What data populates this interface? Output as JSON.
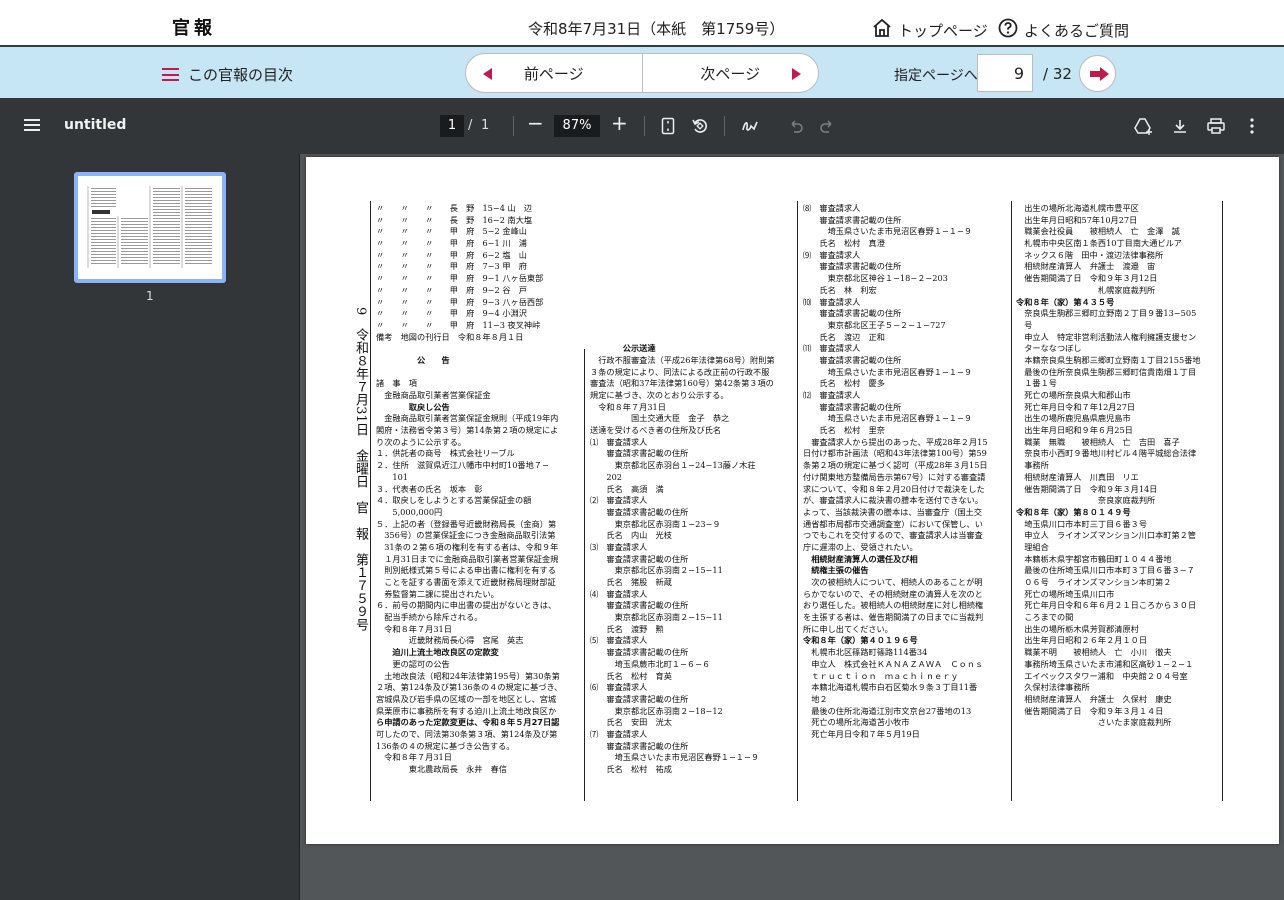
{
  "site": {
    "logo": "官報",
    "issue_title": "令和8年7月31日（本紙　第1759号）",
    "top_link": "トップページ",
    "faq_link": "よくあるご質問"
  },
  "nav": {
    "toc_label": "この官報の目次",
    "prev_label": "前ページ",
    "next_label": "次ページ",
    "goto_label": "指定ページへ",
    "current_page": "9",
    "total_pages": "/ 32"
  },
  "pdf_toolbar": {
    "title": "untitled",
    "page_current": "1",
    "page_sep": "/",
    "page_total": "1",
    "zoom": "87%"
  },
  "sidebar": {
    "thumbnail_label": "1"
  },
  "document": {
    "masthead": "9　令和８年７月31日　金曜日　官　報　第１７５９号",
    "columns": [
      [
        "〃　　〃　　〃　　長　野　15−4 山　辺",
        "〃　　〃　　〃　　長　野　16−2 南大塩",
        "〃　　〃　　〃　　甲　府　5−2 金峰山",
        "〃　　〃　　〃　　甲　府　6−1 川　浦",
        "〃　　〃　　〃　　甲　府　6−2 塩　山",
        "〃　　〃　　〃　　甲　府　7−3 甲　府",
        "〃　　〃　　〃　　甲　府　9−1 八ヶ岳東部",
        "〃　　〃　　〃　　甲　府　9−2 谷　戸",
        "〃　　〃　　〃　　甲　府　9−3 八ヶ岳西部",
        "〃　　〃　　〃　　甲　府　9−4 小淵沢",
        "〃　　〃　　〃　　甲　府　11−3 夜叉神峠",
        "備考　地図の刊行日　令和８年８月１日",
        "",
        "　　　　　公　　告",
        "",
        "諸　事　項",
        "　金融商品取引業者営業保証金",
        "　　　　取戻し公告",
        "　金融商品取引業者営業保証金規則（平成19年内",
        "閣府・法務省令第３号）第14条第２項の規定によ",
        "り次のように公示する。",
        "１．供託者の商号　株式会社リーブル",
        "２．住所　滋賀県近江八幡市中村町10番地７−",
        "　　101",
        "３．代表者の氏名　坂本　彰",
        "４．取戻しをしようとする営業保証金の額",
        "　　5,000,000円",
        "５．上記の者（登録番号近畿財務局長（金商）第",
        "　356号）の営業保証金につき金融商品取引法第",
        "　31条の２第６項の権利を有する者は、令和９年",
        "　１月31日までに金融商品取引業者営業保証金規",
        "　則別紙様式第５号による申出書に権利を有する",
        "　ことを証する書面を添えて近畿財務局理財部証",
        "　券監督第二課に提出されたい。",
        "６．前号の期間内に申出書の提出がないときは、",
        "　配当手続から除斥される。",
        "　令和８年７月31日",
        "　　　　近畿財務局長心得　宮尾　英志",
        "　　迫川上流土地改良区の定款変",
        "　　更の認可の公告",
        "　土地改良法（昭和24年法律第195号）第30条第",
        "２項、第124条及び第136条の４の規定に基づき、",
        "宮城県及び岩手県の区域の一部を地区とし、宮城",
        "県栗原市に事務所を有する迫川上流土地改良区か",
        "ら申請のあった定款変更は、令和８年５月27日認",
        "可したので、同法第30条第３項、第124条及び第",
        "136条の４の規定に基づき公告する。",
        "　令和８年７月31日",
        "　　　　東北農政局長　永井　春信"
      ],
      [
        "",
        "",
        "",
        "",
        "",
        "",
        "",
        "",
        "",
        "",
        "",
        "",
        "　　　　公示送達",
        "　行政不服審査法（平成26年法律第68号）附則第",
        "３条の規定により、同法による改正前の行政不服",
        "審査法（昭和37年法律第160号）第42条第３項の",
        "規定に基づき、次のとおり公示する。",
        "　令和８年７月31日",
        "　　　　　国土交通大臣　金子　恭之",
        "送達を受けるべき者の住所及び氏名",
        "⑴　審査請求人",
        "　　審査請求書記載の住所",
        "　　　東京都北区赤羽台１−24−13藤ノ木荘",
        "　　202",
        "　　氏名　高須　満",
        "⑵　審査請求人",
        "　　審査請求書記載の住所",
        "　　　東京都北区赤羽南１−23−９",
        "　　氏名　内山　光枝",
        "⑶　審査請求人",
        "　　審査請求書記載の住所",
        "　　　東京都北区赤羽南２−15−11",
        "　　氏名　猪股　新蔵",
        "⑷　審査請求人",
        "　　審査請求書記載の住所",
        "　　　東京都北区赤羽南２−15−11",
        "　　氏名　渡野　勲",
        "⑸　審査請求人",
        "　　審査請求書記載の住所",
        "　　　埼玉県蕨市北町１−６−６",
        "　　氏名　松村　育英",
        "⑹　審査請求人",
        "　　審査請求書記載の住所",
        "　　　東京都北区赤羽南２−18−12",
        "　　氏名　安田　洸太",
        "⑺　審査請求人",
        "　　審査請求書記載の住所",
        "　　　埼玉県さいたま市見沼区春野１−１−９",
        "　　氏名　松村　祐成"
      ],
      [
        "⑻　審査請求人",
        "　　審査請求書記載の住所",
        "　　　埼玉県さいたま市見沼区春野１−１−９",
        "　　氏名　松村　真澄",
        "⑼　審査請求人",
        "　　審査請求書記載の住所",
        "　　　東京都北区神谷１−18−２−203",
        "　　氏名　林　利宏",
        "⑽　審査請求人",
        "　　審査請求書記載の住所",
        "　　　東京都北区王子５−２−１−727",
        "　　氏名　渡辺　正和",
        "⑾　審査請求人",
        "　　審査請求書記載の住所",
        "　　　埼玉県さいたま市見沼区春野１−１−９",
        "　　氏名　松村　慶多",
        "⑿　審査請求人",
        "　　審査請求書記載の住所",
        "　　　埼玉県さいたま市見沼区春野１−１−９",
        "　　氏名　松村　里奈",
        "　審査請求人から提出のあった、平成28年２月15",
        "日付け都市計画法（昭和43年法律第100号）第59",
        "条第２項の規定に基づく認可（平成28年３月15日",
        "付け関東地方整備局告示第67号）に対する審査請",
        "求について、令和８年２月20日付けで裁決をした",
        "が、審査請求人に裁決書の謄本を送付できない。",
        "よって、当該裁決書の謄本は、当審査庁（国土交",
        "通省都市局都市交通調査室）において保管し、い",
        "つでもこれを交付するので、審査請求人は当審査",
        "庁に遅滞の上、受領されたい。",
        "　相続財産清算人の選任及び相",
        "　続権主張の催告",
        "　次の被相続人について、相続人のあることが明",
        "らかでないので、その相続財産の清算人を次のと",
        "おり選任した。被相続人の相続財産に対し相続権",
        "を主張する者は、催告期間満了の日までに当裁判",
        "所に申し出てください。",
        "令和８年（家）第４０１９６号",
        "　札幌市北区篠路町篠路114番34",
        "　申立人　株式会社ＫＡＮＡＺＡＷＡ　Ｃｏｎｓ",
        "　ｔｒｕｃｔｉｏｎ　ｍａｃｈｉｎｅｒｙ",
        "　本籍北海道札幌市白石区菊水９条３丁目11番",
        "　地２",
        "　最後の住所北海道江別市文京台27番地の13",
        "　死亡の場所北海道苫小牧市",
        "　死亡年月日令和７年５月19日"
      ],
      [
        "　出生の場所北海道札幌市豊平区",
        "　出生年月日昭和57年10月27日",
        "　職業会社役員　　被相続人　亡　金澤　誠",
        "　札幌市中央区南１条西10丁目南大通ビルア",
        "　ネックス６階　田中・渡辺法律事務所",
        "　相続財産清算人　弁護士　渡邉　宙",
        "　催告期間満了日　令和９年３月12日",
        "　　　　　　　　　　札幌家庭裁判所",
        "令和８年（家）第４３５号",
        "　奈良県生駒郡三郷町立野南２丁目９番13−505",
        "　号",
        "　申立人　特定非営利活動法人権利擁護支援セン",
        "　ターななつぼし",
        "　本籍奈良県生駒郡三郷町立野南１丁目2155番地",
        "　最後の住所奈良県生駒郡三郷町信貴南畑１丁目",
        "　１番１号",
        "　死亡の場所奈良県大和郡山市",
        "　死亡年月日令和７年12月27日",
        "　出生の場所鹿児島県鹿児島市",
        "　出生年月日昭和９年６月25日",
        "　職業　無職　　被相続人　亡　吉田　喜子",
        "　奈良市小西町９番地川村ビル４階平城総合法律",
        "　事務所",
        "　相続財産清算人　川真田　リエ",
        "　催告期間満了日　令和９年３月14日",
        "　　　　　　　　　　奈良家庭裁判所",
        "令和８年（家）第８０１４９号",
        "　埼玉県川口市本町三丁目６番３号",
        "　申立人　ライオンズマンション川口本町第２管",
        "　理組合",
        "　本籍栃木県宇都宮市鶴田町１０４４番地",
        "　最後の住所埼玉県川口市本町３丁目６番３−７",
        "　０６号　ライオンズマンション本町第２",
        "　死亡の場所埼玉県川口市",
        "　死亡年月日令和６年６月２１日ころから３０日",
        "　ころまでの間",
        "　出生の場所栃木県芳賀郡清原村",
        "　出生年月日昭和２６年２月１０日",
        "　職業不明　　被相続人　亡　小川　徹夫",
        "　事務所埼玉県さいたま市浦和区高砂１−２−１",
        "　エイペックスタワー浦和　中央館２０４号室",
        "　久保村法律事務所",
        "　相続財産清算人　弁護士　久保村　康史",
        "　催告期間満了日　令和９年３月１４日",
        "　　　　　　　　　　さいたま家庭裁判所"
      ]
    ]
  }
}
